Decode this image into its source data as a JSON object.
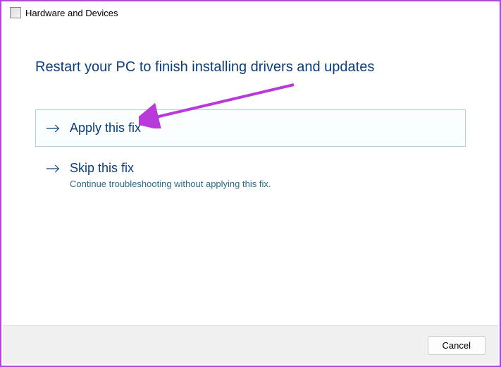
{
  "window": {
    "title": "Hardware and Devices"
  },
  "heading": "Restart your PC to finish installing drivers and updates",
  "options": {
    "apply": {
      "title": "Apply this fix"
    },
    "skip": {
      "title": "Skip this fix",
      "desc": "Continue troubleshooting without applying this fix."
    }
  },
  "footer": {
    "cancel": "Cancel"
  }
}
